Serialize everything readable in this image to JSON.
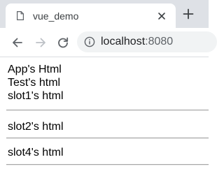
{
  "browser": {
    "tab": {
      "title": "vue_demo",
      "favicon_icon": "document-icon",
      "close_icon": "close-icon"
    },
    "new_tab_icon": "plus-icon",
    "nav": {
      "back_icon": "arrow-left-icon",
      "forward_icon": "arrow-right-icon",
      "reload_icon": "reload-icon"
    },
    "address": {
      "info_icon": "info-icon",
      "host": "localhost",
      "port": ":8080"
    }
  },
  "page": {
    "app_html": "App's Html",
    "test_html": "Test's html",
    "slot1_html": "slot1's html",
    "slot2_html": "slot2's html",
    "slot4_html": "slot4's html"
  },
  "colors": {
    "tabstrip": "#dee1e6",
    "omnibox": "#f1f3f4",
    "text": "#000000"
  }
}
